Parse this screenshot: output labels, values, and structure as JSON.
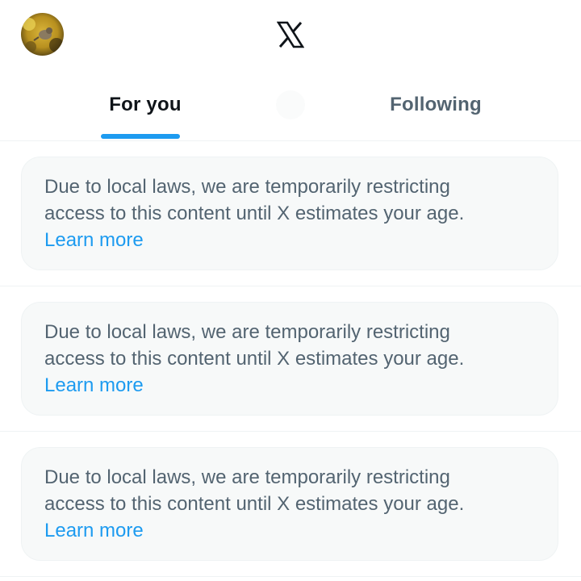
{
  "header": {
    "avatar_icon": "profile-avatar",
    "logo_icon": "x-logo"
  },
  "tabs": [
    {
      "label": "For you",
      "active": true
    },
    {
      "label": "Following",
      "active": false
    }
  ],
  "colors": {
    "accent": "#1d9bf0",
    "text_primary": "#0f1419",
    "text_secondary": "#536471",
    "notice_bg": "#f7f9f9",
    "divider": "#eff3f4"
  },
  "feed": [
    {
      "notice_line1": "Due to local laws, we are temporarily restricting",
      "notice_line2": "access to this content until X estimates your age.",
      "link_label": "Learn more"
    },
    {
      "notice_line1": "Due to local laws, we are temporarily restricting",
      "notice_line2": "access to this content until X estimates your age.",
      "link_label": "Learn more"
    },
    {
      "notice_line1": "Due to local laws, we are temporarily restricting",
      "notice_line2": "access to this content until X estimates your age.",
      "link_label": "Learn more"
    }
  ]
}
